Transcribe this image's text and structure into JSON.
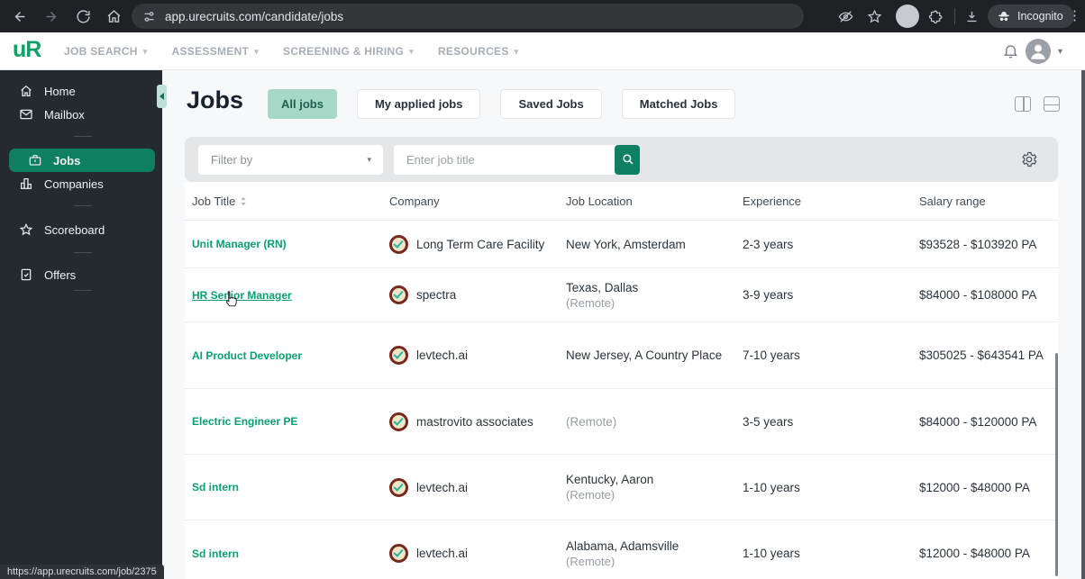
{
  "browser": {
    "url": "app.urecruits.com/candidate/jobs",
    "incognito_label": "Incognito"
  },
  "navbar": {
    "logo_text": "uR",
    "menus": [
      {
        "label": "JOB SEARCH"
      },
      {
        "label": "ASSESSMENT"
      },
      {
        "label": "SCREENING & HIRING"
      },
      {
        "label": "RESOURCES"
      }
    ]
  },
  "sidebar": {
    "active_item": "Jobs",
    "items": [
      {
        "label": "Home"
      },
      {
        "label": "Mailbox"
      },
      {
        "label": "Jobs"
      },
      {
        "label": "Companies"
      },
      {
        "label": "Scoreboard"
      },
      {
        "label": "Offers"
      }
    ]
  },
  "page": {
    "title": "Jobs",
    "tabs": [
      {
        "label": "All jobs",
        "active": true
      },
      {
        "label": "My applied jobs",
        "active": false
      },
      {
        "label": "Saved Jobs",
        "active": false
      },
      {
        "label": "Matched Jobs",
        "active": false
      }
    ]
  },
  "filters": {
    "filter_by_label": "Filter by",
    "search_placeholder": "Enter job title"
  },
  "table": {
    "headers": [
      "Job Title",
      "Company",
      "Job Location",
      "Experience",
      "Salary range"
    ],
    "rows": [
      {
        "title": "Unit Manager (RN)",
        "company": "Long Term Care Facility",
        "location": "New York, Amsterdam",
        "remote": "",
        "experience": "2-3 years",
        "salary": "$93528 - $103920 PA"
      },
      {
        "title": "HR Senior Manager",
        "company": "spectra",
        "location": "Texas, Dallas",
        "remote": "(Remote)",
        "experience": "3-9 years",
        "salary": "$84000 - $108000 PA"
      },
      {
        "title": "AI Product Developer",
        "company": "levtech.ai",
        "location": "New Jersey, A Country Place",
        "remote": "",
        "experience": "7-10 years",
        "salary": "$305025 - $643541 PA"
      },
      {
        "title": "Electric Engineer PE",
        "company": "mastrovito associates",
        "location": "(Remote)",
        "remote": "",
        "experience": "3-5 years",
        "salary": "$84000 - $120000 PA"
      },
      {
        "title": "Sd intern",
        "company": "levtech.ai",
        "location": "Kentucky, Aaron",
        "remote": "(Remote)",
        "experience": "1-10 years",
        "salary": "$12000 - $48000 PA"
      },
      {
        "title": "Sd intern",
        "company": "levtech.ai",
        "location": "Alabama, Adamsville",
        "remote": "(Remote)",
        "experience": "1-10 years",
        "salary": "$12000 - $48000 PA"
      }
    ]
  },
  "statusbar": {
    "link_preview": "https://app.urecruits.com/job/2375"
  },
  "colors": {
    "brand_green": "#0e8060",
    "active_tab_bg": "#a5d8c6",
    "job_link_green": "#0aa06e",
    "sidebar_bg": "#252a30",
    "browser_bar_bg": "#1f2125",
    "filter_panel_bg": "#e4e6e8"
  }
}
